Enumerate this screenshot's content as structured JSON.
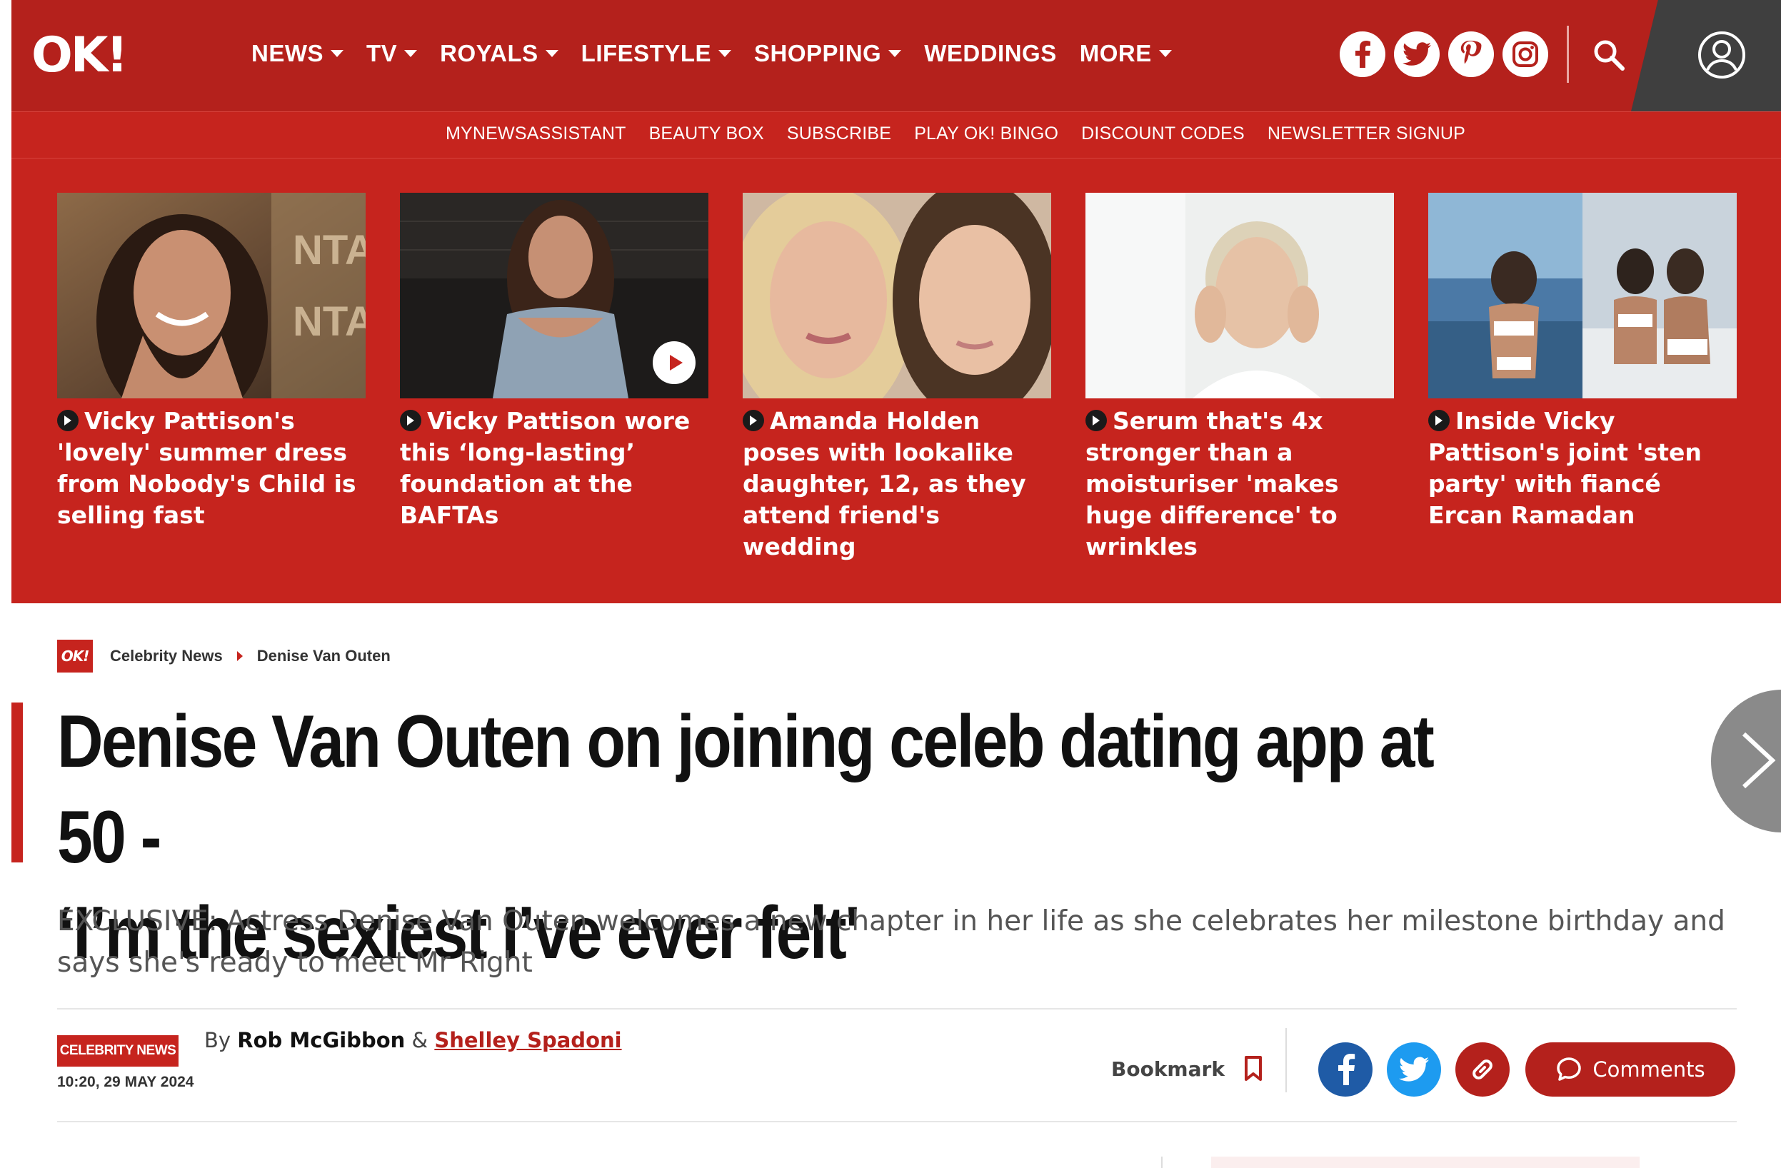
{
  "brand": {
    "logo": "OK!",
    "accent": "#b4211c",
    "accent_light": "#c6241e"
  },
  "nav": {
    "items": [
      {
        "label": "NEWS",
        "has_menu": true
      },
      {
        "label": "TV",
        "has_menu": true
      },
      {
        "label": "ROYALS",
        "has_menu": true
      },
      {
        "label": "LIFESTYLE",
        "has_menu": true
      },
      {
        "label": "SHOPPING",
        "has_menu": true
      },
      {
        "label": "WEDDINGS",
        "has_menu": false
      },
      {
        "label": "MORE",
        "has_menu": true
      }
    ],
    "social_icons": [
      "facebook-icon",
      "twitter-icon",
      "pinterest-icon",
      "instagram-icon"
    ],
    "search_icon": "search-icon",
    "account_icon": "account-icon"
  },
  "subnav": {
    "items": [
      "MYNEWSASSISTANT",
      "BEAUTY BOX",
      "SUBSCRIBE",
      "PLAY OK! BINGO",
      "DISCOUNT CODES",
      "NEWSLETTER SIGNUP"
    ]
  },
  "teasers": [
    {
      "title": "Vicky Pattison's 'lovely' summer dress from Nobody's Child is selling fast",
      "video": false
    },
    {
      "title": "Vicky Pattison wore this ‘long-lasting’ foundation at the BAFTAs",
      "video": true
    },
    {
      "title": "Amanda Holden poses with lookalike daughter, 12, as they attend friend's wedding",
      "video": false
    },
    {
      "title": "Serum that's 4x stronger than a moisturiser 'makes huge difference' to wrinkles",
      "video": false
    },
    {
      "title": "Inside Vicky Pattison's joint 'sten party' with fiancé Ercan Ramadan",
      "video": false
    }
  ],
  "breadcrumb": {
    "badge": "OK!",
    "items": [
      "Celebrity News",
      "Denise Van Outen"
    ]
  },
  "article": {
    "headline_line1": "Denise Van Outen on joining celeb dating app at 50 -",
    "headline_line2": "‘I’m the sexiest I’ve ever felt'",
    "standfirst": "EXCLUSIVE: Actress Denise Van Outen welcomes a new chapter in her life as she celebrates her milestone birthday and says she's ready to meet Mr Right",
    "category": "CELEBRITY NEWS",
    "timestamp": "10:20, 29 MAY 2024",
    "byline_prefix": "By",
    "author1": "Rob McGibbon",
    "byline_sep": "&",
    "author2": "Shelley Spadoni"
  },
  "actions": {
    "bookmark_label": "Bookmark",
    "comments_label": "Comments",
    "share_icons": [
      "facebook-share-icon",
      "twitter-share-icon",
      "link-share-icon"
    ],
    "share_colors": {
      "facebook": "#1f5ba6",
      "twitter": "#1d9bf0",
      "link": "#b4211c"
    }
  }
}
